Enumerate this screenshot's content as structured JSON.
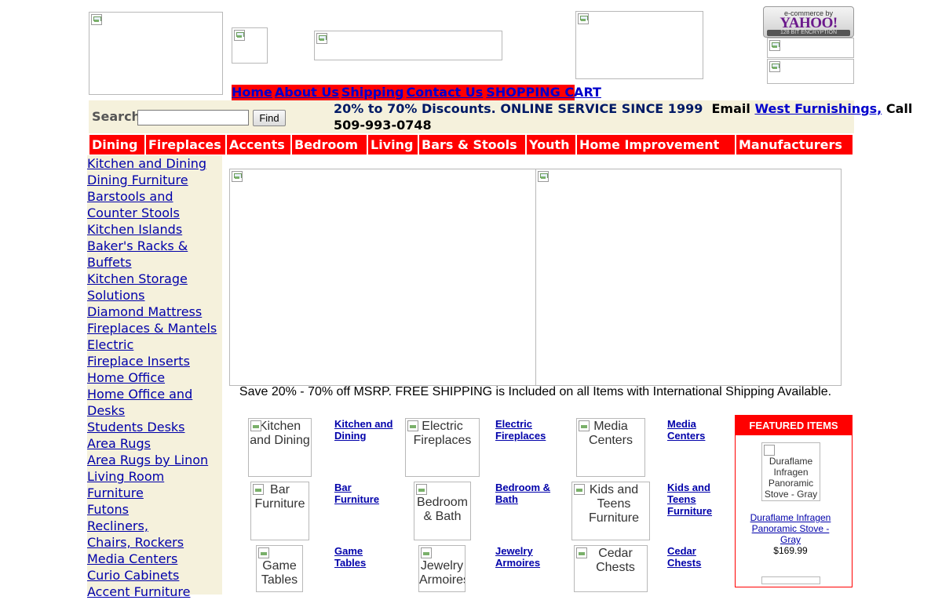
{
  "header": {
    "yahoo_badge": {
      "line1": "e-commerce by",
      "logo": "YAHOO!",
      "line3": "128 BIT ENCRYPTION"
    }
  },
  "top_nav": [
    {
      "label": "Home"
    },
    {
      "label": "About Us"
    },
    {
      "label": "Shipping"
    },
    {
      "label": "Contact Us"
    },
    {
      "label": "SHOPPING CART"
    }
  ],
  "search": {
    "label": "Search",
    "value": "",
    "button": "Find"
  },
  "promo": {
    "text": "20% to 70% Discounts. ONLINE SERVICE SINCE 1999",
    "email_label": "Email",
    "email_link": "West Furnishings,",
    "call_label": "Call",
    "phone": "509-993-0748"
  },
  "categories": [
    {
      "label": "Dining"
    },
    {
      "label": "Fireplaces"
    },
    {
      "label": "Accents"
    },
    {
      "label": "Bedroom"
    },
    {
      "label": "Living"
    },
    {
      "label": "Bars & Stools"
    },
    {
      "label": "Youth"
    },
    {
      "label": "Home Improvement"
    },
    {
      "label": "Manufacturers"
    }
  ],
  "sidebar": {
    "links": [
      {
        "label": "Kitchen and Dining"
      },
      {
        "label": "Dining Furniture"
      },
      {
        "label": "Barstools and Counter Stools"
      },
      {
        "label": "Kitchen Islands"
      },
      {
        "label": "Baker's Racks & Buffets"
      },
      {
        "label": "Kitchen Storage Solutions"
      },
      {
        "label": "Diamond Mattress"
      },
      {
        "label": "Fireplaces & Mantels"
      },
      {
        "label": "Electric Fireplace Inserts"
      },
      {
        "label": "Home Office"
      },
      {
        "label": "Home Office and Desks"
      },
      {
        "label": "Students Desks"
      },
      {
        "label": "Area Rugs"
      },
      {
        "label": "Area Rugs by Linon"
      },
      {
        "label": "Living Room Furniture"
      },
      {
        "label": "Futons"
      },
      {
        "label": "Recliners, Chairs, Rockers"
      },
      {
        "label": "Media Centers"
      },
      {
        "label": "Curio Cabinets"
      },
      {
        "label": "Accent Furniture"
      }
    ]
  },
  "main": {
    "caption": "Save 20% - 70% off MSRP. FREE SHIPPING is Included on all Items with International Shipping Available.",
    "grid": [
      {
        "img_alt": "Kitchen and Dining",
        "link": "Kitchen and Dining"
      },
      {
        "img_alt": "Electric Fireplaces",
        "link": "Electric Fireplaces"
      },
      {
        "img_alt": "Media Centers",
        "link": "Media Centers"
      },
      {
        "img_alt": "Bar Furniture",
        "link": "Bar Furniture"
      },
      {
        "img_alt": "Bedroom & Bath",
        "link": "Bedroom & Bath"
      },
      {
        "img_alt": "Kids and Teens Furniture",
        "link": "Kids and Teens Furniture"
      },
      {
        "img_alt": "Game Tables",
        "link": "Game Tables"
      },
      {
        "img_alt": "Jewelry Armoires",
        "link": "Jewelry Armoires"
      },
      {
        "img_alt": "Cedar Chests",
        "link": "Cedar Chests"
      }
    ]
  },
  "featured": {
    "title": "FEATURED ITEMS",
    "item": {
      "img_alt": "Duraflame Infragen Panoramic Stove - Gray",
      "link": "Duraflame Infragen Panoramic Stove - Gray",
      "price": "$169.99"
    }
  }
}
